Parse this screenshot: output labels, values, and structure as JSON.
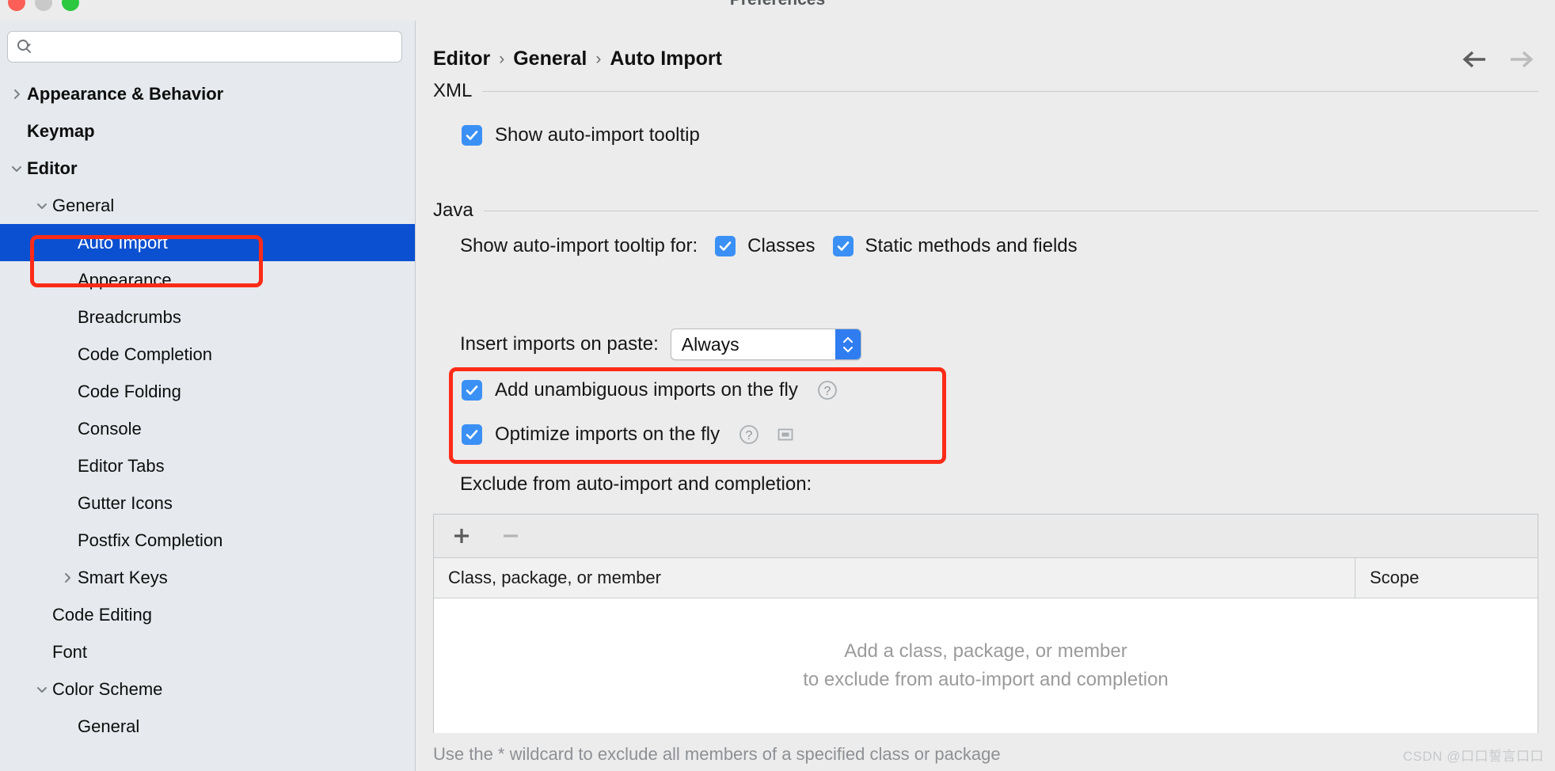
{
  "window": {
    "title": "Preferences",
    "traffic_lights": [
      "close-button",
      "minimize-button",
      "zoom-button"
    ]
  },
  "sidebar": {
    "search": {
      "value": "",
      "placeholder": ""
    },
    "items": [
      {
        "label": "Appearance & Behavior",
        "level": 0,
        "twisty": "right",
        "bold": true,
        "selected": false
      },
      {
        "label": "Keymap",
        "level": 0,
        "twisty": "none",
        "bold": true,
        "selected": false
      },
      {
        "label": "Editor",
        "level": 0,
        "twisty": "down",
        "bold": true,
        "selected": false
      },
      {
        "label": "General",
        "level": 1,
        "twisty": "down",
        "bold": false,
        "selected": false
      },
      {
        "label": "Auto Import",
        "level": 2,
        "twisty": "none",
        "bold": false,
        "selected": true
      },
      {
        "label": "Appearance",
        "level": 2,
        "twisty": "none",
        "bold": false,
        "selected": false
      },
      {
        "label": "Breadcrumbs",
        "level": 2,
        "twisty": "none",
        "bold": false,
        "selected": false
      },
      {
        "label": "Code Completion",
        "level": 2,
        "twisty": "none",
        "bold": false,
        "selected": false
      },
      {
        "label": "Code Folding",
        "level": 2,
        "twisty": "none",
        "bold": false,
        "selected": false
      },
      {
        "label": "Console",
        "level": 2,
        "twisty": "none",
        "bold": false,
        "selected": false
      },
      {
        "label": "Editor Tabs",
        "level": 2,
        "twisty": "none",
        "bold": false,
        "selected": false
      },
      {
        "label": "Gutter Icons",
        "level": 2,
        "twisty": "none",
        "bold": false,
        "selected": false
      },
      {
        "label": "Postfix Completion",
        "level": 2,
        "twisty": "none",
        "bold": false,
        "selected": false
      },
      {
        "label": "Smart Keys",
        "level": 2,
        "twisty": "right",
        "bold": false,
        "selected": false
      },
      {
        "label": "Code Editing",
        "level": 1,
        "twisty": "none",
        "bold": false,
        "selected": false
      },
      {
        "label": "Font",
        "level": 1,
        "twisty": "none",
        "bold": false,
        "selected": false
      },
      {
        "label": "Color Scheme",
        "level": 1,
        "twisty": "down",
        "bold": false,
        "selected": false
      },
      {
        "label": "General",
        "level": 2,
        "twisty": "none",
        "bold": false,
        "selected": false
      }
    ]
  },
  "main": {
    "breadcrumb": {
      "parts": [
        "Editor",
        "General",
        "Auto Import"
      ],
      "separator": "›"
    },
    "nav": {
      "back": "back-arrow",
      "forward": "forward-arrow"
    },
    "xml": {
      "heading": "XML",
      "show_tooltip": {
        "label": "Show auto-import tooltip",
        "checked": true
      }
    },
    "java": {
      "heading": "Java",
      "tooltip_for_label": "Show auto-import tooltip for:",
      "tooltip_for_options": [
        {
          "label": "Classes",
          "checked": true
        },
        {
          "label": "Static methods and fields",
          "checked": true
        }
      ],
      "insert_on_paste_label": "Insert imports on paste:",
      "insert_on_paste_value": "Always",
      "fly_options": [
        {
          "label": "Add unambiguous imports on the fly",
          "checked": true,
          "has_help": true,
          "has_scope": false
        },
        {
          "label": "Optimize imports on the fly",
          "checked": true,
          "has_help": true,
          "has_scope": true
        }
      ],
      "exclude_label": "Exclude from auto-import and completion:",
      "table": {
        "add_button": "+",
        "remove_button": "−",
        "columns": [
          "Class, package, or member",
          "Scope"
        ],
        "rows": [],
        "empty_line1": "Add a class, package, or member",
        "empty_line2": "to exclude from auto-import and completion"
      },
      "footnote": "Use the * wildcard to exclude all members of a specified class or package"
    }
  },
  "annotations": {
    "highlight_color": "#fc2b18",
    "boxes": [
      "sidebar-auto-import-highlight",
      "fly-options-highlight"
    ]
  },
  "watermark": "CSDN @口口誓言口口",
  "colors": {
    "accent_checkbox": "#3b90f5",
    "selection_blue": "#0b50d0",
    "annotation_red": "#fc2b18",
    "sidebar_bg": "#e6eaee",
    "panel_bg": "#ececec"
  }
}
